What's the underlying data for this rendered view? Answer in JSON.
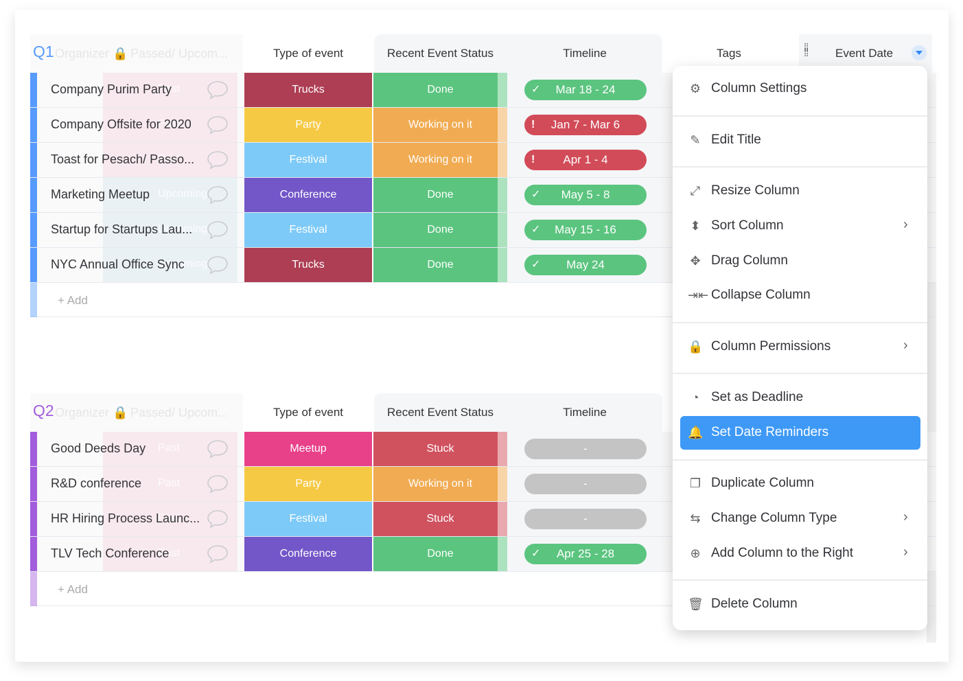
{
  "columns": {
    "type": "Type of event",
    "status": "Recent Event Status",
    "timeline": "Timeline",
    "tags": "Tags",
    "event_date": "Event Date",
    "organizer_ghost": "Organizer",
    "passed_ghost": "Passed/ Upcom..."
  },
  "groups": [
    {
      "title": "Q1",
      "color": "#579bfc",
      "add_label": "+ Add",
      "rows": [
        {
          "name": "Company Purim Party",
          "passed": "Past",
          "type": "Trucks",
          "type_color": "#ad3e54",
          "status": "Done",
          "status_color": "#5bc47f",
          "timeline": "Mar 18 - 24",
          "timeline_state": "done"
        },
        {
          "name": "Company Offsite for 2020",
          "passed": "Past",
          "type": "Party",
          "type_color": "#f6c945",
          "status": "Working on it",
          "status_color": "#f1ab52",
          "timeline": "Jan 7 - Mar 6",
          "timeline_state": "overdue"
        },
        {
          "name": "Toast for Pesach/ Passo...",
          "passed": "Past",
          "type": "Festival",
          "type_color": "#7dcaf8",
          "status": "Working on it",
          "status_color": "#f1ab52",
          "timeline": "Apr 1 - 4",
          "timeline_state": "overdue"
        },
        {
          "name": "Marketing Meetup",
          "passed": "Upcoming",
          "type": "Conference",
          "type_color": "#7356c8",
          "status": "Done",
          "status_color": "#5bc47f",
          "timeline": "May 5 - 8",
          "timeline_state": "done"
        },
        {
          "name": "Startup for Startups Lau...",
          "passed": "Upcoming",
          "type": "Festival",
          "type_color": "#7dcaf8",
          "status": "Done",
          "status_color": "#5bc47f",
          "timeline": "May 15 - 16",
          "timeline_state": "done"
        },
        {
          "name": "NYC Annual Office Sync",
          "passed": "Upcoming",
          "type": "Trucks",
          "type_color": "#ad3e54",
          "status": "Done",
          "status_color": "#5bc47f",
          "timeline": "May 24",
          "timeline_state": "done"
        }
      ]
    },
    {
      "title": "Q2",
      "color": "#a25ddc",
      "add_label": "+ Add",
      "rows": [
        {
          "name": "Good Deeds Day",
          "passed": "Past",
          "type": "Meetup",
          "type_color": "#e8418a",
          "status": "Stuck",
          "status_color": "#d0525f",
          "timeline": "-",
          "timeline_state": "empty"
        },
        {
          "name": "R&D conference",
          "passed": "Past",
          "type": "Party",
          "type_color": "#f6c945",
          "status": "Working on it",
          "status_color": "#f1ab52",
          "timeline": "-",
          "timeline_state": "empty"
        },
        {
          "name": "HR Hiring Process Launc...",
          "passed": "Past",
          "type": "Festival",
          "type_color": "#7dcaf8",
          "status": "Stuck",
          "status_color": "#d0525f",
          "timeline": "-",
          "timeline_state": "empty"
        },
        {
          "name": "TLV Tech Conference",
          "passed": "Past",
          "type": "Conference",
          "type_color": "#7356c8",
          "status": "Done",
          "status_color": "#5bc47f",
          "timeline": "Apr 25 - 28",
          "timeline_state": "done"
        }
      ]
    }
  ],
  "timeline_colors": {
    "done": "#5bc47f",
    "overdue": "#d24b58",
    "empty": "#c4c4c4"
  },
  "menu": {
    "items": [
      {
        "label": "Column Settings",
        "icon": "gear-icon",
        "glyph": "⚙",
        "submenu": false
      },
      {
        "label": "Edit Title",
        "icon": "pencil-icon",
        "glyph": "✎",
        "submenu": false
      },
      {
        "label": "Resize Column",
        "icon": "resize-icon",
        "glyph": "⤢",
        "submenu": false
      },
      {
        "label": "Sort Column",
        "icon": "sort-icon",
        "glyph": "⬍",
        "submenu": true
      },
      {
        "label": "Drag Column",
        "icon": "move-icon",
        "glyph": "✥",
        "submenu": false
      },
      {
        "label": "Collapse Column",
        "icon": "collapse-icon",
        "glyph": "⇥⇤",
        "submenu": false
      },
      {
        "label": "Column Permissions",
        "icon": "lock-icon",
        "glyph": "🔒",
        "submenu": true
      },
      {
        "label": "Set as Deadline",
        "icon": "deadline-icon",
        "glyph": "◔",
        "submenu": false
      },
      {
        "label": "Set Date Reminders",
        "icon": "bell-icon",
        "glyph": "🔔",
        "submenu": false,
        "active": true
      },
      {
        "label": "Duplicate Column",
        "icon": "duplicate-icon",
        "glyph": "❐",
        "submenu": false
      },
      {
        "label": "Change Column Type",
        "icon": "swap-icon",
        "glyph": "⇆",
        "submenu": true
      },
      {
        "label": "Add Column to the Right",
        "icon": "add-circle-icon",
        "glyph": "⊕",
        "submenu": true
      },
      {
        "label": "Delete Column",
        "icon": "trash-icon",
        "glyph": "🗑",
        "submenu": false
      }
    ],
    "chevron": "›",
    "active_color": "#3e99f6"
  }
}
